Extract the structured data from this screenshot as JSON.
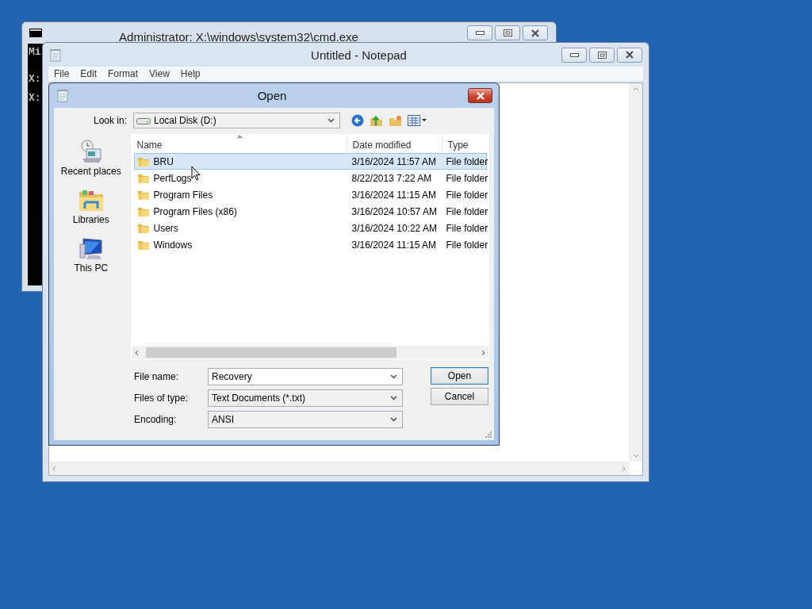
{
  "cmd_window": {
    "title": "Administrator: X:\\windows\\system32\\cmd.exe",
    "console_lines": [
      "Mi",
      "X:",
      "X:"
    ]
  },
  "notepad_window": {
    "title": "Untitled - Notepad",
    "menu": [
      "File",
      "Edit",
      "Format",
      "View",
      "Help"
    ]
  },
  "open_dialog": {
    "title": "Open",
    "look_in": {
      "label": "Look in:",
      "value": "Local Disk (D:)"
    },
    "places": [
      {
        "label": "Recent places",
        "kind": "recent"
      },
      {
        "label": "Libraries",
        "kind": "libraries"
      },
      {
        "label": "This PC",
        "kind": "pc"
      }
    ],
    "columns": [
      "Name",
      "Date modified",
      "Type"
    ],
    "rows": [
      {
        "name": "BRU",
        "date": "3/16/2024 11:57 AM",
        "type": "File folder",
        "selected": true
      },
      {
        "name": "PerfLogs",
        "date": "8/22/2013 7:22 AM",
        "type": "File folder",
        "selected": false
      },
      {
        "name": "Program Files",
        "date": "3/16/2024 11:15 AM",
        "type": "File folder",
        "selected": false
      },
      {
        "name": "Program Files (x86)",
        "date": "3/16/2024 10:57 AM",
        "type": "File folder",
        "selected": false
      },
      {
        "name": "Users",
        "date": "3/16/2024 10:22 AM",
        "type": "File folder",
        "selected": false
      },
      {
        "name": "Windows",
        "date": "3/16/2024 11:15 AM",
        "type": "File folder",
        "selected": false
      }
    ],
    "file_name": {
      "label": "File name:",
      "value": "Recovery"
    },
    "files_of_type": {
      "label": "Files of type:",
      "value": "Text Documents (*.txt)"
    },
    "encoding": {
      "label": "Encoding:",
      "value": "ANSI"
    },
    "buttons": [
      {
        "label": "Open",
        "kind": "default"
      },
      {
        "label": "Cancel",
        "kind": "normal"
      }
    ]
  }
}
